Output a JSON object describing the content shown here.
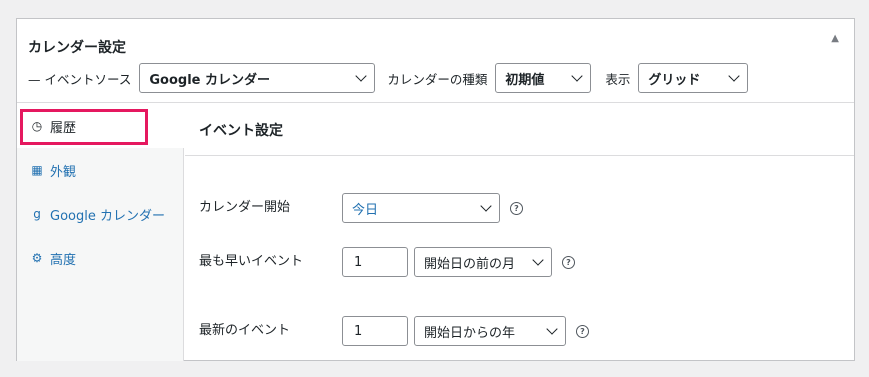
{
  "panel": {
    "title": "カレンダー設定",
    "source_label": "— イベントソース",
    "source_value": "Google カレンダー",
    "type_label": "カレンダーの種類",
    "type_value": "初期値",
    "display_label": "表示",
    "display_value": "グリッド"
  },
  "sidebar": {
    "items": [
      {
        "label": "履歴",
        "icon": "clock-icon",
        "active": true
      },
      {
        "label": "外観",
        "icon": "calendar-icon",
        "active": false
      },
      {
        "label": "Google カレンダー",
        "icon": "google-icon",
        "active": false
      },
      {
        "label": "高度",
        "icon": "gears-icon",
        "active": false
      }
    ]
  },
  "main": {
    "title": "イベント設定",
    "calendar_start": {
      "label": "カレンダー開始",
      "value": "今日"
    },
    "earliest_event": {
      "label": "最も早いイベント",
      "number": "1",
      "unit": "開始日の前の月"
    },
    "latest_event": {
      "label": "最新のイベント",
      "number": "1",
      "unit": "開始日からの年"
    }
  },
  "colors": {
    "accent": "#2271b1",
    "highlight": "#e5185f",
    "background": "#f0f0f1"
  }
}
